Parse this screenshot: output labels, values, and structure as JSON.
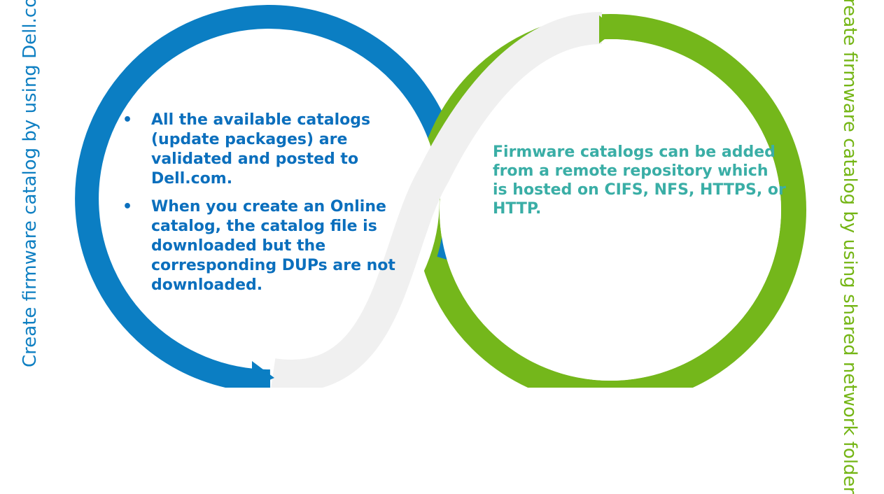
{
  "diagram": {
    "colors": {
      "blue": "#0b7ec3",
      "green": "#74b71b",
      "gray": "#f0f0f0",
      "white": "#ffffff",
      "teal_text": "#3aaea6"
    },
    "left_title": "Create firmware catalog by using Dell.com or online",
    "right_title": "Create firmware catalog by using shared network folder",
    "left_bullets": [
      "All the available catalogs (update packages) are validated and posted to Dell.com.",
      "When you create an Online catalog, the catalog file is downloaded but the corresponding DUPs are not downloaded."
    ],
    "bullet_symbol": "•",
    "right_text": "Firmware catalogs can be added from a remote repository which is hosted on CIFS, NFS, HTTPS, or HTTP."
  }
}
